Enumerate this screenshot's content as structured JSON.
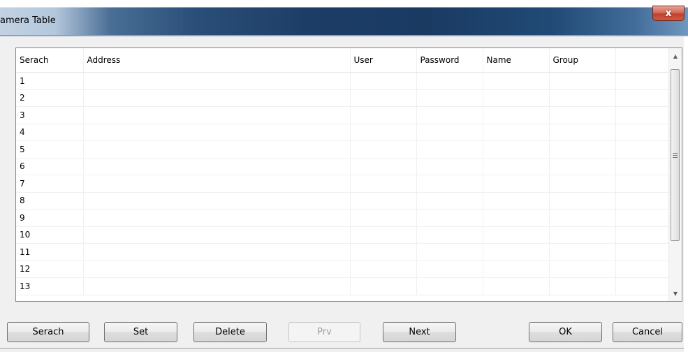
{
  "window": {
    "title": "amera Table",
    "close_label": "x"
  },
  "table": {
    "columns": [
      "Serach",
      "Address",
      "User",
      "Password",
      "Name",
      "Group",
      ""
    ],
    "rows": [
      "1",
      "2",
      "3",
      "4",
      "5",
      "6",
      "7",
      "8",
      "9",
      "10",
      "11",
      "12",
      "13"
    ]
  },
  "buttons": {
    "search": "Serach",
    "set": "Set",
    "delete": "Delete",
    "prev": "Prv",
    "next": "Next",
    "ok": "OK",
    "cancel": "Cancel"
  },
  "colors": {
    "title_bar": "#1c3d66",
    "close_button": "#c2412b"
  },
  "icons": [
    "close-icon",
    "scroll-up-arrow-icon",
    "scroll-down-arrow-icon",
    "scroll-grip-icon"
  ]
}
